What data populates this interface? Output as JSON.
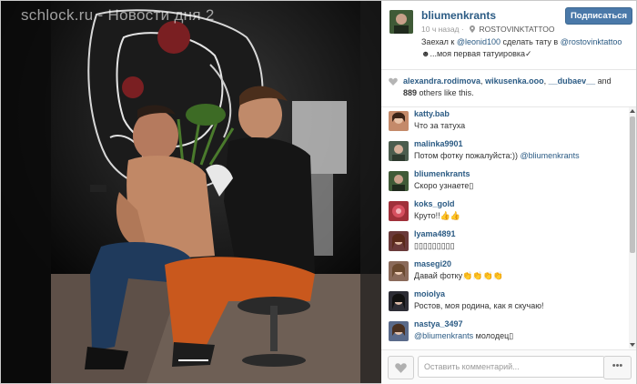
{
  "watermark": "schlock.ru - Новости дня 2",
  "post": {
    "username": "bliumenkrants",
    "follow_label": "Подписаться",
    "time": "10 ч назад",
    "location": "ROSTOVINKTATTOO",
    "caption": {
      "part1": "Заехал к ",
      "mention1": "@leonid100",
      "part2": " сделать тату в ",
      "mention2": "@rostovinktattoo",
      "part3": " ☻...моя первая татуировка✓"
    }
  },
  "likes": {
    "user1": "alexandra.rodimova",
    "user2": "wikusenka.ooo",
    "user3": "__dubaev__",
    "and": "and",
    "count": "889",
    "suffix": "others like this."
  },
  "comments": [
    {
      "user": "katty.bab",
      "text": "Что за татуха",
      "avatar_color": "#c48a6a"
    },
    {
      "user": "malinka9901",
      "text": "Потом фотку пожалуйста:))",
      "mention": "@bliumenkrants",
      "avatar_color": "#4b5d4e"
    },
    {
      "user": "bliumenkrants",
      "text": "Скоро узнаете▯",
      "avatar_color": "#3f5a37"
    },
    {
      "user": "koks_gold",
      "text": "Круто!!👍👍",
      "avatar_color": "#a0303a"
    },
    {
      "user": "lyama4891",
      "text": "▯▯▯▯▯▯▯▯▯",
      "avatar_color": "#6a3a3a"
    },
    {
      "user": "masegi20",
      "text": "Давай фотку👏👏👏👏",
      "avatar_color": "#8a6a5a"
    },
    {
      "user": "moiolya",
      "text": "Ростов, моя родина, как я скучаю!",
      "avatar_color": "#2d2d35"
    },
    {
      "user": "nastya_3497",
      "text": " молодец▯",
      "mention": "@bliumenkrants",
      "avatar_color": "#5a6a8a"
    }
  ],
  "footer": {
    "comment_placeholder": "Оставить комментарий...",
    "more_label": "•••"
  },
  "colors": {
    "link": "#2b5b84",
    "follow_button": "#4a79a9"
  }
}
